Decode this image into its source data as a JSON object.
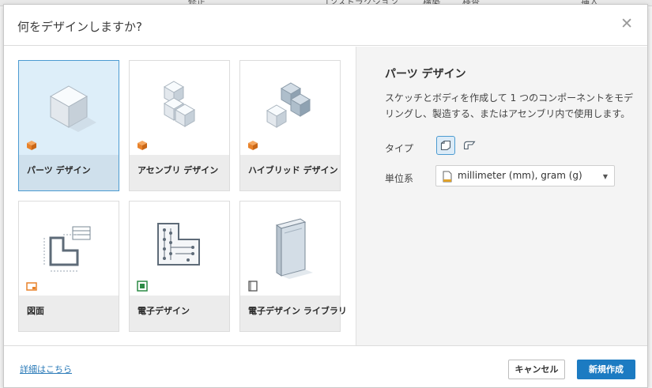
{
  "background_app": {
    "header_fragments": [
      "修正",
      "コンストラクション",
      "構築",
      "検査",
      "挿入"
    ]
  },
  "dialog": {
    "title": "何をデザインしますか?",
    "close_glyph": "✕"
  },
  "cards": [
    {
      "label": "パーツ デザイン",
      "icon": "part-design-icon",
      "selected": true
    },
    {
      "label": "アセンブリ デザイン",
      "icon": "assembly-design-icon",
      "selected": false
    },
    {
      "label": "ハイブリッド デザイン",
      "icon": "hybrid-design-icon",
      "selected": false
    },
    {
      "label": "図面",
      "icon": "drawing-icon",
      "selected": false
    },
    {
      "label": "電子デザイン",
      "icon": "electronics-design-icon",
      "selected": false
    },
    {
      "label": "電子デザイン ライブラリ",
      "icon": "electronics-library-icon",
      "selected": false
    }
  ],
  "panel": {
    "title": "パーツ デザイン",
    "description": "スケッチとボディを作成して 1 つのコンポーネントをモデリングし、製造する、またはアセンブリ内で使用します。",
    "type_label": "タイプ",
    "type_options": [
      "solid-part-icon",
      "sheet-metal-icon"
    ],
    "unit_label": "単位系",
    "unit_value": "millimeter (mm), gram (g)"
  },
  "footer": {
    "learn_more": "詳細はこちら",
    "cancel": "キャンセル",
    "create": "新規作成"
  },
  "colors": {
    "accent": "#1c7bc2",
    "selection_border": "#4c9bd1",
    "selection_fill": "#ddeef9",
    "badge_orange": "#e8822a"
  }
}
